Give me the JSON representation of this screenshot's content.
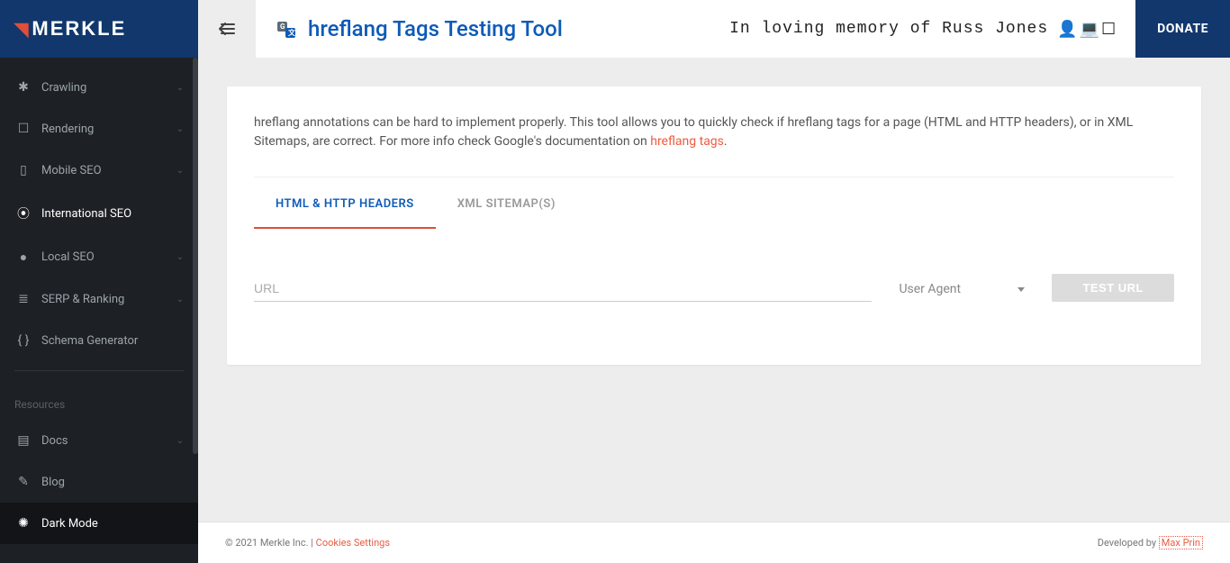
{
  "brand": "MERKLE",
  "header": {
    "title": "hreflang Tags Testing Tool",
    "tribute": "In loving memory of Russ Jones",
    "donate": "DONATE"
  },
  "sidebar": {
    "items": [
      {
        "icon": "bug",
        "label": "Crawling",
        "expandable": true,
        "active": false
      },
      {
        "icon": "screen",
        "label": "Rendering",
        "expandable": true,
        "active": false
      },
      {
        "icon": "mobile",
        "label": "Mobile SEO",
        "expandable": true,
        "active": false
      },
      {
        "icon": "globe",
        "label": "International SEO",
        "expandable": false,
        "active": true
      },
      {
        "icon": "pin",
        "label": "Local SEO",
        "expandable": true,
        "active": false
      },
      {
        "icon": "list",
        "label": "SERP & Ranking",
        "expandable": true,
        "active": false
      },
      {
        "icon": "braces",
        "label": "Schema Generator",
        "expandable": false,
        "active": false
      }
    ],
    "resources_heading": "Resources",
    "resources": [
      {
        "icon": "docs",
        "label": "Docs",
        "expandable": true
      },
      {
        "icon": "pen",
        "label": "Blog",
        "expandable": false
      }
    ],
    "dark_mode": {
      "icon": "gear",
      "label": "Dark Mode"
    }
  },
  "main": {
    "intro_prefix": "hreflang annotations can be hard to implement properly. This tool allows you to quickly check if hreflang tags for a page (HTML and HTTP headers), or in XML Sitemaps, are correct. For more info check Google's documentation on ",
    "intro_link": "hreflang tags",
    "intro_suffix": ".",
    "tabs": [
      {
        "label": "HTML & HTTP HEADERS",
        "active": true
      },
      {
        "label": "XML SITEMAP(S)",
        "active": false
      }
    ],
    "url_placeholder": "URL",
    "ua_label": "User Agent",
    "test_button": "TEST URL"
  },
  "footer": {
    "copyright": "© 2021 Merkle Inc. | ",
    "cookies": "Cookies Settings",
    "developed_prefix": "Developed by ",
    "developed_link": "Max Prin"
  }
}
